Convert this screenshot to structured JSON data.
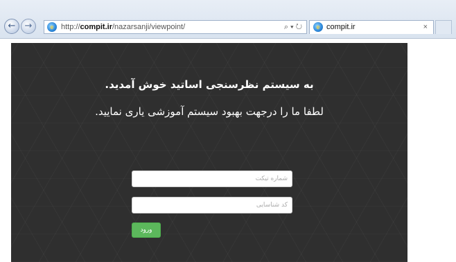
{
  "browser": {
    "url_domain": "compit.ir",
    "url_prefix": "http://",
    "url_path": "/nazarsanji/viewpoint/",
    "address_tools": "⌕ ▾ ↻",
    "tab_title": "compit.ir",
    "tab_close": "×",
    "back_glyph": "←",
    "forward_glyph": "→"
  },
  "page": {
    "welcome": "به سیستم نظرسنجی اساتید  خوش آمدید.",
    "subtitle": "لطفا ما را درجهت بهبود سیستم آموزشی یاری نمایید.",
    "ticket_placeholder": "شماره تیکت",
    "code_placeholder": "کد شناسایی",
    "login_label": "ورود"
  },
  "colors": {
    "panel_bg": "#2f2f2f",
    "button_green": "#5cb85c"
  }
}
